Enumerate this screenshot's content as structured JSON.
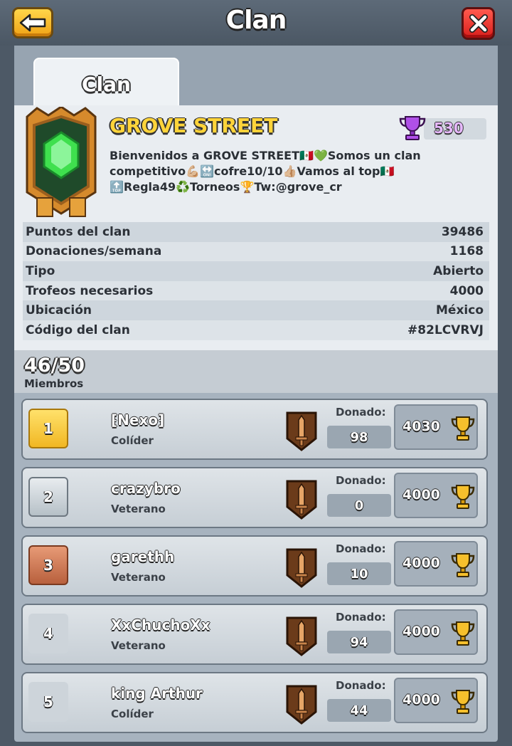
{
  "header": {
    "title": "Clan"
  },
  "tabs": [
    {
      "label": "Clan"
    }
  ],
  "clan": {
    "name": "GROVE STREET",
    "trophies": "530",
    "description": "Bienvenidos a GROVE STREET🇲🇽💚Somos un clan competitivo💪🏼🔛cofre10/10👍🏼Vamos al top🇲🇽🔝Regla49♻️Torneos🏆Tw:@grove_cr",
    "stats": [
      {
        "label": "Puntos del clan",
        "value": "39486"
      },
      {
        "label": "Donaciones/semana",
        "value": "1168"
      },
      {
        "label": "Tipo",
        "value": "Abierto"
      },
      {
        "label": "Trofeos necesarios",
        "value": "4000"
      },
      {
        "label": "Ubicación",
        "value": "México"
      },
      {
        "label": "Código del clan",
        "value": "#82LCVRVJ"
      }
    ]
  },
  "members_section": {
    "count": "46/50",
    "label": "Miembros"
  },
  "members": [
    {
      "rank": "1",
      "name": "⁅Nexo⁆",
      "role": "Colíder",
      "donated_label": "Donado:",
      "donated": "98",
      "trophies": "4030"
    },
    {
      "rank": "2",
      "name": "crazybro",
      "role": "Veterano",
      "donated_label": "Donado:",
      "donated": "0",
      "trophies": "4000"
    },
    {
      "rank": "3",
      "name": "garethh",
      "role": "Veterano",
      "donated_label": "Donado:",
      "donated": "10",
      "trophies": "4000"
    },
    {
      "rank": "4",
      "name": "XxChuchoXx",
      "role": "Veterano",
      "donated_label": "Donado:",
      "donated": "94",
      "trophies": "4000"
    },
    {
      "rank": "5",
      "name": "king Arthur",
      "role": "Colíder",
      "donated_label": "Donado:",
      "donated": "44",
      "trophies": "4000"
    }
  ],
  "icons": {
    "back": "arrow-left-icon",
    "close": "close-icon",
    "badge": "clan-badge-icon",
    "trophy": "trophy-icon",
    "arena": "sword-shield-icon"
  },
  "colors": {
    "back_button": "#f0a316",
    "close_button": "#d91f1c",
    "clan_name": "#ffd43a",
    "clan_trophy": "#e7b9ff"
  }
}
